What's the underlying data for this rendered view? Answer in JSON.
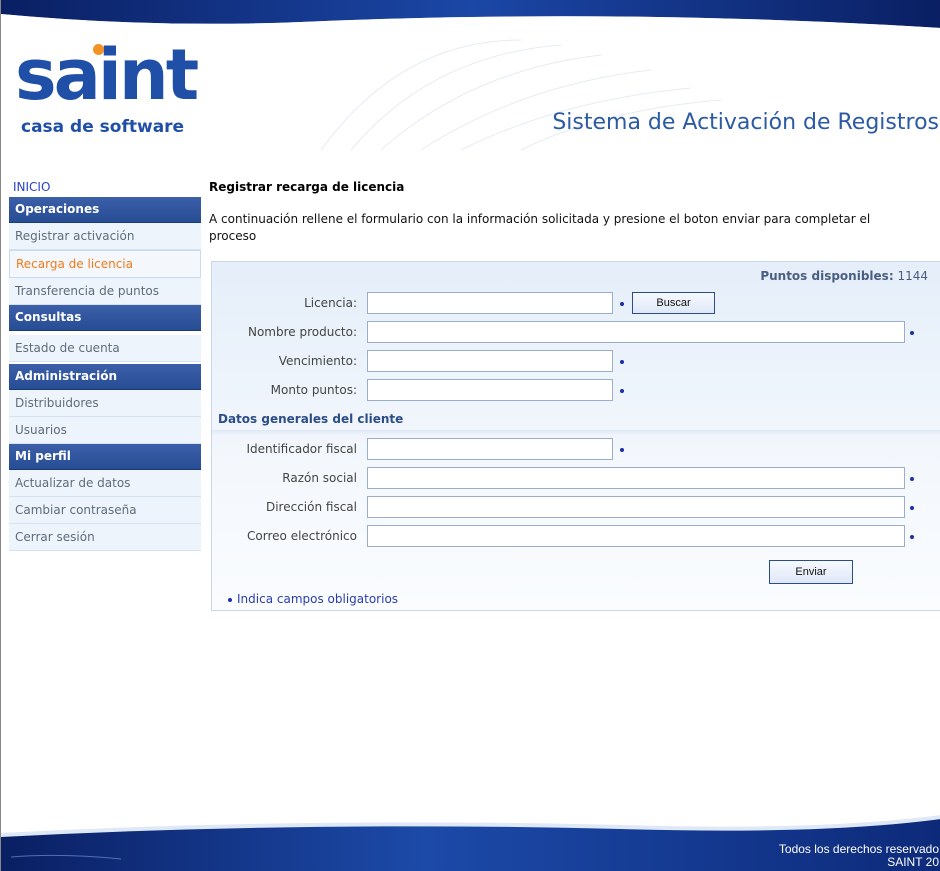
{
  "header": {
    "logo_word": "saint",
    "logo_sub": "casa de software",
    "system_title": "Sistema de Activación de Registros"
  },
  "sidebar": {
    "home": "INICIO",
    "sections": [
      {
        "title": "Operaciones",
        "items": [
          "Registrar activación",
          "Recarga de licencia",
          "Transferencia de puntos"
        ]
      },
      {
        "title": "Consultas",
        "items": [
          "Estado de cuenta"
        ]
      },
      {
        "title": "Administración",
        "items": [
          "Distribuidores",
          "Usuarios"
        ]
      },
      {
        "title": "Mi perfil",
        "items": [
          "Actualizar de datos",
          "Cambiar contraseña",
          "Cerrar sesión"
        ]
      }
    ],
    "active_item": "Recarga de licencia"
  },
  "main": {
    "heading": "Registrar recarga de licencia",
    "intro": "A continuación rellene el formulario con la información solicitada y presione el boton enviar para completar el proceso",
    "points_label": "Puntos disponibles:",
    "points_value": "1144",
    "fields": {
      "licencia": {
        "label": "Licencia:",
        "value": ""
      },
      "nombre_producto": {
        "label": "Nombre producto:",
        "value": ""
      },
      "vencimiento": {
        "label": "Vencimiento:",
        "value": ""
      },
      "monto_puntos": {
        "label": "Monto puntos:",
        "value": ""
      },
      "identificador_fiscal": {
        "label": "Identificador fiscal",
        "value": ""
      },
      "razon_social": {
        "label": "Razón social",
        "value": ""
      },
      "direccion_fiscal": {
        "label": "Dirección fiscal",
        "value": ""
      },
      "correo": {
        "label": "Correo electrónico",
        "value": ""
      }
    },
    "client_section": "Datos generales del cliente",
    "search_button": "Buscar",
    "submit_button": "Enviar",
    "required_note": "Indica campos obligatorios"
  },
  "footer": {
    "line1": "Todos los derechos reservado",
    "line2": "SAINT 20"
  },
  "colors": {
    "brand_blue": "#1f4fa6",
    "accent_orange": "#f39325",
    "active_item": "#f07a18",
    "footer_navy": "#0b2a78"
  }
}
